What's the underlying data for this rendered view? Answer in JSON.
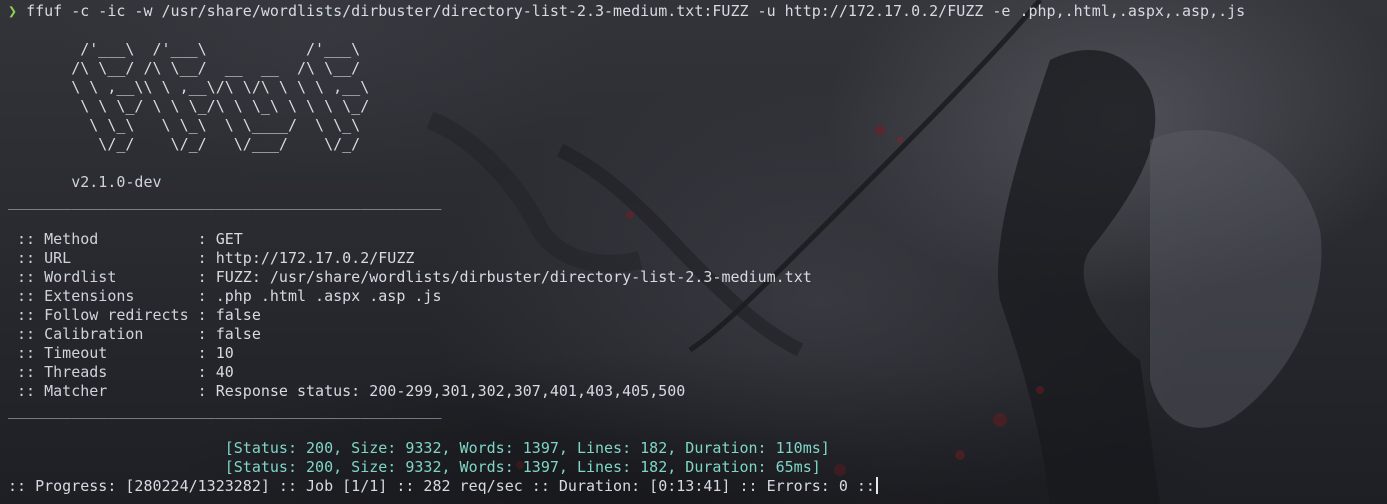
{
  "terminal": {
    "prompt_symbol": "❯",
    "command": "ffuf -c -ic -w /usr/share/wordlists/dirbuster/directory-list-2.3-medium.txt:FUZZ -u http://172.17.0.2/FUZZ -e .php,.html,.aspx,.asp,.js",
    "banner": [
      "        /'___\\  /'___\\           /'___\\",
      "       /\\ \\__/ /\\ \\__/  __  __  /\\ \\__/",
      "       \\ \\ ,__\\\\ \\ ,__\\/\\ \\/\\ \\ \\ \\ ,__\\",
      "        \\ \\ \\_/ \\ \\ \\_/\\ \\ \\_\\ \\ \\ \\ \\_/",
      "         \\ \\_\\   \\ \\_\\  \\ \\____/  \\ \\_\\",
      "          \\/_/    \\/_/   \\/___/    \\/_/"
    ],
    "version": "       v2.1.0-dev",
    "separator": "________________________________________________",
    "config": [
      {
        "key": " :: Method           : ",
        "value": "GET"
      },
      {
        "key": " :: URL              : ",
        "value": "http://172.17.0.2/FUZZ"
      },
      {
        "key": " :: Wordlist         : ",
        "value": "FUZZ: /usr/share/wordlists/dirbuster/directory-list-2.3-medium.txt"
      },
      {
        "key": " :: Extensions       : ",
        "value": ".php .html .aspx .asp .js"
      },
      {
        "key": " :: Follow redirects : ",
        "value": "false"
      },
      {
        "key": " :: Calibration      : ",
        "value": "false"
      },
      {
        "key": " :: Timeout          : ",
        "value": "10"
      },
      {
        "key": " :: Threads          : ",
        "value": "40"
      },
      {
        "key": " :: Matcher          : ",
        "value": "Response status: 200-299,301,302,307,401,403,405,500"
      }
    ],
    "results": [
      "                        [Status: 200, Size: 9332, Words: 1397, Lines: 182, Duration: 110ms]",
      "                        [Status: 200, Size: 9332, Words: 1397, Lines: 182, Duration: 65ms]"
    ],
    "progress": ":: Progress: [280224/1323282] :: Job [1/1] :: 282 req/sec :: Duration: [0:13:41] :: Errors: 0 ::",
    "colors": {
      "prompt": "#8fd14f",
      "result": "#7fd6c7",
      "text": "#d6dae2"
    }
  }
}
